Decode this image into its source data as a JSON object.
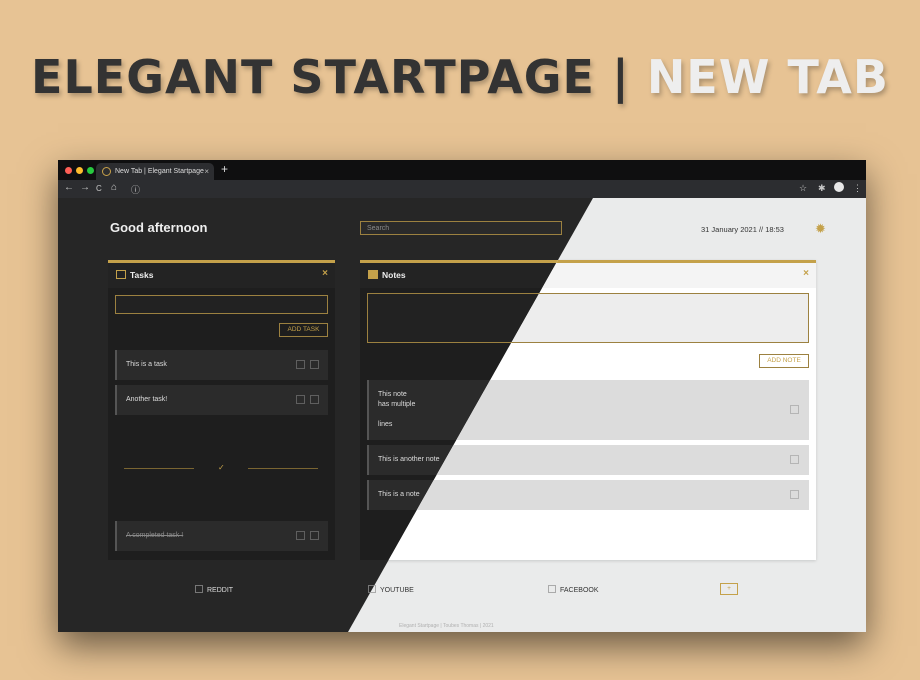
{
  "headline": {
    "part1": "ELEGANT STARTPAGE |",
    "part2": "NEW TAB"
  },
  "browser": {
    "tab_title": "New Tab | Elegant Startpage",
    "tab_close": "×",
    "new_tab": "+",
    "nav": {
      "back": "←",
      "forward": "→",
      "reload": "C",
      "home": "⌂",
      "info": "ⓘ"
    },
    "right_icons": {
      "star": "☆",
      "extensions": "✱",
      "menu": "⋮"
    },
    "dot_colors": [
      "#ff5f56",
      "#ffbd2e",
      "#27c93f"
    ]
  },
  "page": {
    "greeting": "Good afternoon",
    "search_placeholder": "Search",
    "datetime": "31 January 2021 // 18:53",
    "theme_icon": "sun-icon"
  },
  "tasks": {
    "title": "Tasks",
    "close": "×",
    "add_button": "ADD TASK",
    "items": [
      {
        "text": "This is a task"
      },
      {
        "text": "Another task!"
      }
    ],
    "divider_icon": "✓",
    "completed": [
      {
        "text": "A completed task !"
      }
    ]
  },
  "notes": {
    "title": "Notes",
    "close": "×",
    "add_button": "ADD NOTE",
    "items": [
      {
        "line1": "This note",
        "line2": "has multiple",
        "line3": "lines"
      },
      {
        "line1": "This is another note"
      },
      {
        "line1": "This is a note"
      }
    ]
  },
  "links": [
    {
      "label": "REDDIT"
    },
    {
      "label": "YOUTUBE"
    },
    {
      "label": "FACEBOOK"
    }
  ],
  "add_link": "+",
  "footer": "Elegant Startpage | Toubes Thomas | 2021",
  "colors": {
    "accent": "#c4a14a",
    "dark_bg": "#262626",
    "light_bg": "#eaebeb",
    "page_bg": "#e7c394"
  }
}
